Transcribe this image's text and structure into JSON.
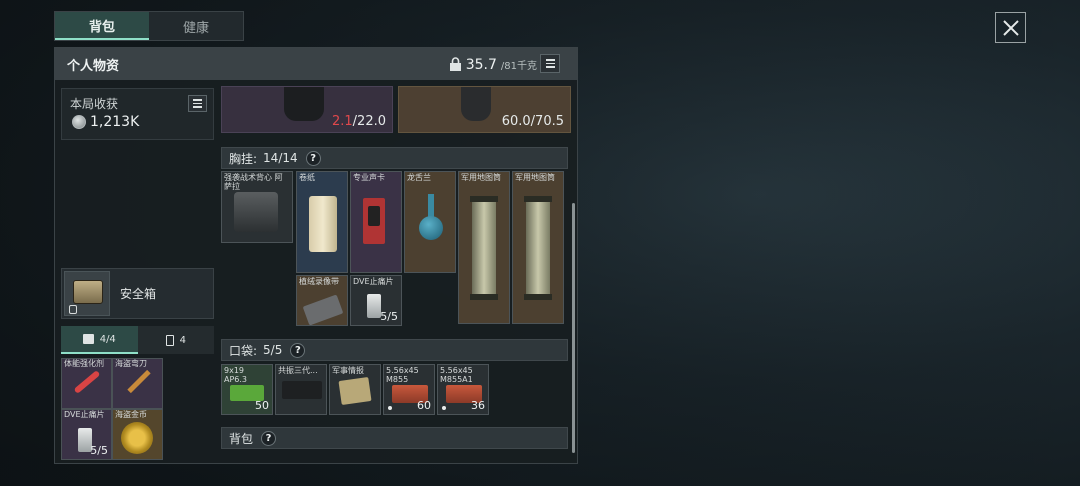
{
  "tabs": [
    {
      "label": "背包",
      "active": true
    },
    {
      "label": "健康",
      "active": false
    }
  ],
  "panel": {
    "title": "个人物资",
    "weight_current": "35.7",
    "weight_max": "/81千克"
  },
  "earnings": {
    "label": "本局收获",
    "value": "1,213K"
  },
  "gear": [
    {
      "value_highlight": "2.1",
      "value_rest": "/22.0",
      "color": "#37303f"
    },
    {
      "value_highlight": "",
      "value_rest": "60.0/70.5",
      "color": "#4d4032"
    }
  ],
  "chest_rig": {
    "label": "胸挂:",
    "count": "14/14",
    "help": "?",
    "items": [
      {
        "name": "强袭战术背心 阿萨拉",
        "icon": "vest-icon",
        "rarity": "dark"
      },
      {
        "name": "卷纸",
        "icon": "paper-roll-icon",
        "rarity": "blue"
      },
      {
        "name": "专业声卡",
        "icon": "sound-card-icon",
        "rarity": "purple"
      },
      {
        "name": "龙舌兰",
        "icon": "flask-icon",
        "rarity": "tan"
      },
      {
        "name": "军用地图筒",
        "icon": "map-tube-icon",
        "rarity": "tan"
      },
      {
        "name": "军用地图筒",
        "icon": "map-tube-icon",
        "rarity": "tan"
      },
      {
        "name": "植绒录像带",
        "icon": "tape-icon",
        "rarity": "tan"
      },
      {
        "name": "DVE止痛片",
        "qty": "5/5",
        "icon": "injector-icon",
        "rarity": "dark"
      }
    ]
  },
  "pockets": {
    "label": "口袋:",
    "count": "5/5",
    "help": "?",
    "items": [
      {
        "name": "9x19 AP6.3",
        "qty": "50",
        "icon": "ammo-icon",
        "rarity": "green"
      },
      {
        "name": "共振三代...",
        "qty": "",
        "icon": "gun-part-icon",
        "rarity": "dark"
      },
      {
        "name": "军事情报",
        "qty": "",
        "icon": "intel-icon",
        "rarity": "dark"
      },
      {
        "name": "5.56x45 M855",
        "qty": "60",
        "icon": "ammo-box-icon",
        "rarity": "dark"
      },
      {
        "name": "5.56x45 M855A1",
        "qty": "36",
        "icon": "ammo-box-icon",
        "rarity": "dark"
      }
    ]
  },
  "backpack": {
    "label": "背包",
    "help": "?"
  },
  "safe_box": {
    "label": "安全箱"
  },
  "pouch_tabs": [
    {
      "label": "4/4",
      "active": true
    },
    {
      "label": "4",
      "active": false
    }
  ],
  "pouch_items": [
    {
      "name": "体能强化剂",
      "qty": "",
      "icon": "stim-pen-icon",
      "rarity": "purple"
    },
    {
      "name": "海盗弯刀",
      "qty": "",
      "icon": "knife-icon",
      "rarity": "purple"
    },
    {
      "name": "DVE止痛片",
      "qty": "5/5",
      "icon": "injector-icon",
      "rarity": "purple"
    },
    {
      "name": "海盗金币",
      "qty": "",
      "icon": "gold-coin-icon",
      "rarity": "gold"
    }
  ],
  "colors": {
    "accent": "#8fe0c8",
    "highlight_red": "#e0484c"
  }
}
